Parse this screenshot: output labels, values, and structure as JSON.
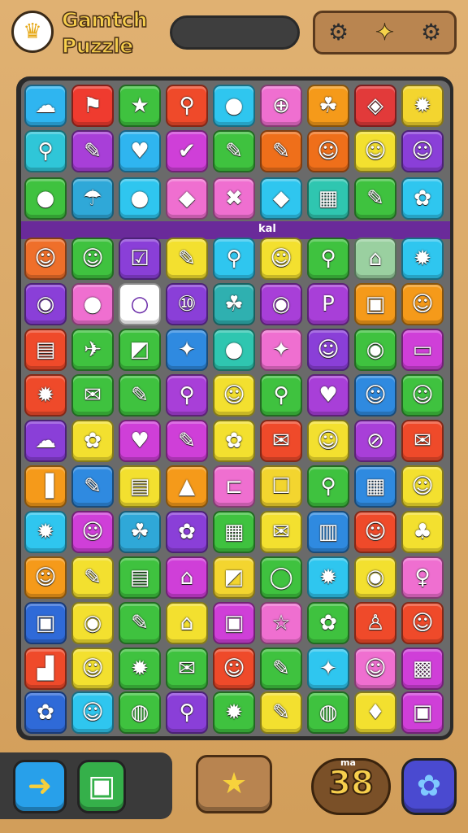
{
  "header": {
    "title_line1": "Gamtch",
    "title_line2": "Puzzle",
    "logo_glyph": "♛",
    "tools": [
      {
        "name": "gear-icon",
        "glyph": "⚙"
      },
      {
        "name": "pin-icon",
        "glyph": "✦"
      },
      {
        "name": "settings-icon",
        "glyph": "⚙"
      }
    ]
  },
  "board": {
    "band_label": "kal",
    "rows": [
      [
        [
          "#2fb5f0",
          "☁"
        ],
        [
          "#ef3b2f",
          "⚑"
        ],
        [
          "#3fc23f",
          "★"
        ],
        [
          "#ef4a2a",
          "⚲"
        ],
        [
          "#2fc6ef",
          "●"
        ],
        [
          "#ef6fd0",
          "⊕"
        ],
        [
          "#f59a1a",
          "☘"
        ],
        [
          "#e23a3a",
          "◈"
        ],
        [
          "#f3d52f",
          "✹"
        ]
      ],
      [
        [
          "#2fc6d8",
          "⚲"
        ],
        [
          "#a83fd8",
          "✎"
        ],
        [
          "#2fb5f0",
          "♥"
        ],
        [
          "#cf3fd8",
          "✔"
        ],
        [
          "#3fc23f",
          "✎"
        ],
        [
          "#ef6f1a",
          "✎"
        ],
        [
          "#ef6f1a",
          "☺"
        ],
        [
          "#f3e02f",
          "☺"
        ],
        [
          "#8a3fd8",
          "☺"
        ]
      ],
      [
        [
          "#3fc23f",
          "●"
        ],
        [
          "#2fa8d8",
          "☂"
        ],
        [
          "#2fc6ef",
          "●"
        ],
        [
          "#ef6fd0",
          "◆"
        ],
        [
          "#ef6fd0",
          "✖"
        ],
        [
          "#2fc6ef",
          "◆"
        ],
        [
          "#2fc6b0",
          "▦"
        ],
        [
          "#3fc23f",
          "✎"
        ],
        [
          "#2fc6ef",
          "✿"
        ]
      ],
      [
        [
          "#ef6f2a",
          "☺"
        ],
        [
          "#3fc23f",
          "☺"
        ],
        [
          "#8a3fd8",
          "☑"
        ],
        [
          "#f3e02f",
          "✎"
        ],
        [
          "#2fc6ef",
          "⚲"
        ],
        [
          "#f3e02f",
          "☺"
        ],
        [
          "#3fc23f",
          "⚲"
        ],
        [
          "#9ad0a0",
          "⌂"
        ],
        [
          "#2fc6ef",
          "✹"
        ]
      ],
      [
        [
          "#8a3fd8",
          "◉"
        ],
        [
          "#ef6fd0",
          "●"
        ],
        [
          "#ffffff",
          "○"
        ],
        [
          "#8a3fd8",
          "⑩"
        ],
        [
          "#2fb0b0",
          "☘"
        ],
        [
          "#a83fd8",
          "◉"
        ],
        [
          "#a83fd8",
          "P"
        ],
        [
          "#f59a1a",
          "▣"
        ],
        [
          "#f59a1a",
          "☺"
        ]
      ],
      [
        [
          "#ef4a2a",
          "▤"
        ],
        [
          "#3fc23f",
          "✈"
        ],
        [
          "#3fc23f",
          "◩"
        ],
        [
          "#2f8ae0",
          "✦"
        ],
        [
          "#2fc6b0",
          "●"
        ],
        [
          "#ef6fd0",
          "✦"
        ],
        [
          "#8a3fd8",
          "☺"
        ],
        [
          "#3fc23f",
          "◉"
        ],
        [
          "#cf3fd8",
          "▭"
        ]
      ],
      [
        [
          "#ef4a2a",
          "✹"
        ],
        [
          "#3fc23f",
          "✉"
        ],
        [
          "#3fc23f",
          "✎"
        ],
        [
          "#a83fd8",
          "⚲"
        ],
        [
          "#f3e02f",
          "☺"
        ],
        [
          "#3fc23f",
          "⚲"
        ],
        [
          "#a83fd8",
          "♥"
        ],
        [
          "#2f8ae0",
          "☺"
        ],
        [
          "#3fc23f",
          "☺"
        ]
      ],
      [
        [
          "#8a3fd8",
          "☁"
        ],
        [
          "#f3e02f",
          "✿"
        ],
        [
          "#cf3fd8",
          "♥"
        ],
        [
          "#cf3fd8",
          "✎"
        ],
        [
          "#f3e02f",
          "✿"
        ],
        [
          "#ef4a2a",
          "✉"
        ],
        [
          "#f3e02f",
          "☺"
        ],
        [
          "#a83fd8",
          "⊘"
        ],
        [
          "#ef4a2a",
          "✉"
        ]
      ],
      [
        [
          "#f59a1a",
          "▐"
        ],
        [
          "#2f8ae0",
          "✎"
        ],
        [
          "#f3e02f",
          "▤"
        ],
        [
          "#f59a1a",
          "▲"
        ],
        [
          "#ef6fd0",
          "⊏"
        ],
        [
          "#f3d52f",
          "☐"
        ],
        [
          "#3fc23f",
          "⚲"
        ],
        [
          "#2f8ae0",
          "▦"
        ],
        [
          "#f3e02f",
          "☺"
        ]
      ],
      [
        [
          "#2fc6ef",
          "✹"
        ],
        [
          "#cf3fd8",
          "☺"
        ],
        [
          "#2fa8d8",
          "☘"
        ],
        [
          "#8a3fd8",
          "✿"
        ],
        [
          "#3fc23f",
          "▦"
        ],
        [
          "#f3e02f",
          "✉"
        ],
        [
          "#2f8ae0",
          "▥"
        ],
        [
          "#ef4a2a",
          "☺"
        ],
        [
          "#f3e02f",
          "♣"
        ]
      ],
      [
        [
          "#f59a1a",
          "☺"
        ],
        [
          "#f3e02f",
          "✎"
        ],
        [
          "#3fc23f",
          "▤"
        ],
        [
          "#cf3fd8",
          "⌂"
        ],
        [
          "#f3d52f",
          "◩"
        ],
        [
          "#3fc23f",
          "◯"
        ],
        [
          "#2fc6ef",
          "✹"
        ],
        [
          "#f3e02f",
          "◉"
        ],
        [
          "#ef6fd0",
          "♀"
        ]
      ],
      [
        [
          "#2f6ad8",
          "▣"
        ],
        [
          "#f3e02f",
          "◉"
        ],
        [
          "#3fc23f",
          "✎"
        ],
        [
          "#f3e02f",
          "⌂"
        ],
        [
          "#cf3fd8",
          "▣"
        ],
        [
          "#ef6fd0",
          "☆"
        ],
        [
          "#3fc23f",
          "✿"
        ],
        [
          "#ef4a2a",
          "♙"
        ],
        [
          "#ef4a2a",
          "☺"
        ]
      ],
      [
        [
          "#ef4a2a",
          "▟"
        ],
        [
          "#f3e02f",
          "☺"
        ],
        [
          "#3fc23f",
          "✹"
        ],
        [
          "#3fc23f",
          "✉"
        ],
        [
          "#ef4a2a",
          "☺"
        ],
        [
          "#3fc23f",
          "✎"
        ],
        [
          "#2fc6ef",
          "✦"
        ],
        [
          "#ef6fd0",
          "☺"
        ],
        [
          "#cf3fd8",
          "▩"
        ]
      ],
      [
        [
          "#2f6ad8",
          "✿"
        ],
        [
          "#2fc6ef",
          "☺"
        ],
        [
          "#3fc23f",
          "◍"
        ],
        [
          "#8a3fd8",
          "⚲"
        ],
        [
          "#3fc23f",
          "✹"
        ],
        [
          "#f3e02f",
          "✎"
        ],
        [
          "#3fc23f",
          "◍"
        ],
        [
          "#f3e02f",
          "♦"
        ],
        [
          "#cf3fd8",
          "▣"
        ]
      ]
    ]
  },
  "footer": {
    "back_glyph": "➜",
    "map_glyph": "▣",
    "star_glyph": "★",
    "score_label": "ma",
    "score_value": "38",
    "settings_glyph": "✿"
  },
  "colors": {
    "accent": "#f7cf4d",
    "background": "#d9a866",
    "board_frame": "#2a2a2a"
  }
}
